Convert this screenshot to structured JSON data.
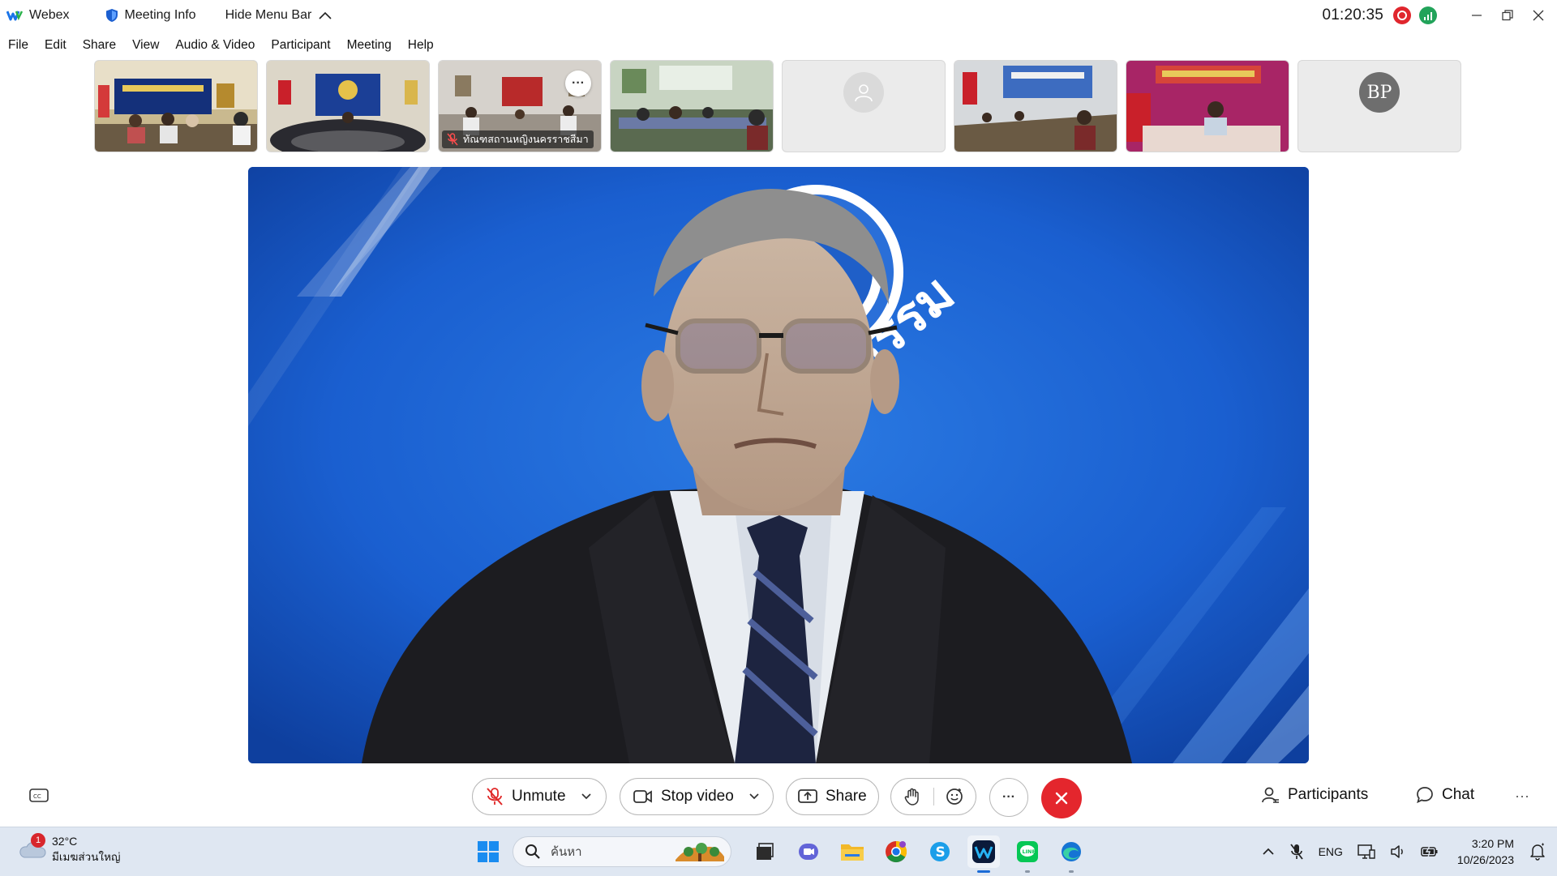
{
  "window": {
    "app_name": "Webex",
    "meeting_info": "Meeting Info",
    "hide_menu_bar": "Hide Menu Bar",
    "timer": "01:20:35"
  },
  "menu": [
    "File",
    "Edit",
    "Share",
    "View",
    "Audio & Video",
    "Participant",
    "Meeting",
    "Help"
  ],
  "thumbnails": [
    {
      "kind": "video",
      "label": ""
    },
    {
      "kind": "video",
      "label": ""
    },
    {
      "kind": "video",
      "label": "ทัณฑสถานหญิงนครราชสีมา",
      "muted": true,
      "more": "···"
    },
    {
      "kind": "video",
      "label": ""
    },
    {
      "kind": "placeholder",
      "label": ""
    },
    {
      "kind": "video",
      "label": ""
    },
    {
      "kind": "video",
      "label": ""
    },
    {
      "kind": "initials",
      "initials": "BP"
    }
  ],
  "main_video": {
    "background_text": "ธรรม"
  },
  "controls": {
    "unmute": "Unmute",
    "stop_video": "Stop video",
    "share": "Share",
    "more": "···",
    "participants": "Participants",
    "chat": "Chat",
    "overflow": "···"
  },
  "taskbar": {
    "weather_badge": "1",
    "weather_temp": "32°C",
    "weather_desc": "มีเมฆส่วนใหญ่",
    "search_placeholder": "ค้นหา",
    "lang": "ENG",
    "time": "3:20 PM",
    "date": "10/26/2023"
  },
  "colors": {
    "end_call": "#e4262d",
    "record": "#e0262d",
    "network": "#22a35a",
    "main_bg": "#1857c7"
  }
}
